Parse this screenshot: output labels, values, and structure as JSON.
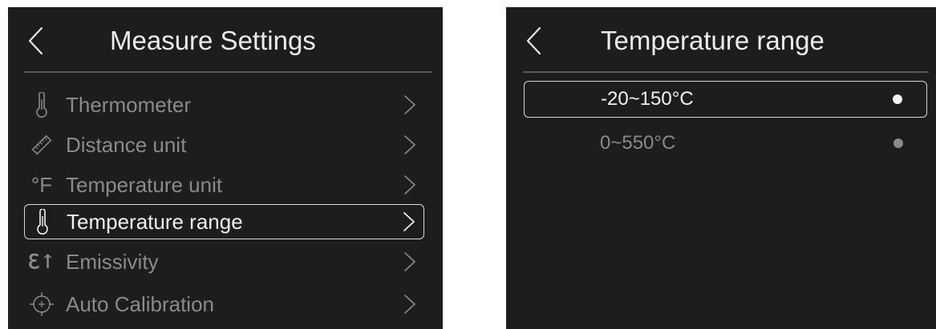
{
  "measure_settings": {
    "title": "Measure Settings",
    "back_icon": "chevron-left-icon",
    "items": [
      {
        "icon": "thermometer-icon",
        "label": "Thermometer",
        "selected": false
      },
      {
        "icon": "ruler-icon",
        "label": "Distance unit",
        "selected": false
      },
      {
        "icon": "fahrenheit-icon",
        "icon_text": "°F",
        "label": "Temperature unit",
        "selected": false
      },
      {
        "icon": "thermometer-icon",
        "label": "Temperature range",
        "selected": true
      },
      {
        "icon": "emissivity-icon",
        "icon_text": "ℇ↑",
        "label": "Emissivity",
        "selected": false
      },
      {
        "icon": "crosshair-icon",
        "label": "Auto Calibration",
        "selected": false
      }
    ]
  },
  "temperature_range": {
    "title": "Temperature range",
    "back_icon": "chevron-left-icon",
    "options": [
      {
        "label": "-20~150°C",
        "selected": true
      },
      {
        "label": "0~550°C",
        "selected": false
      }
    ]
  },
  "colors": {
    "screen_background": "#1d1d1d",
    "title_text": "#ececec",
    "inactive_text": "#8a8a8a",
    "active_text": "#f0f0f0",
    "selection_border": "#d8d8d8"
  }
}
